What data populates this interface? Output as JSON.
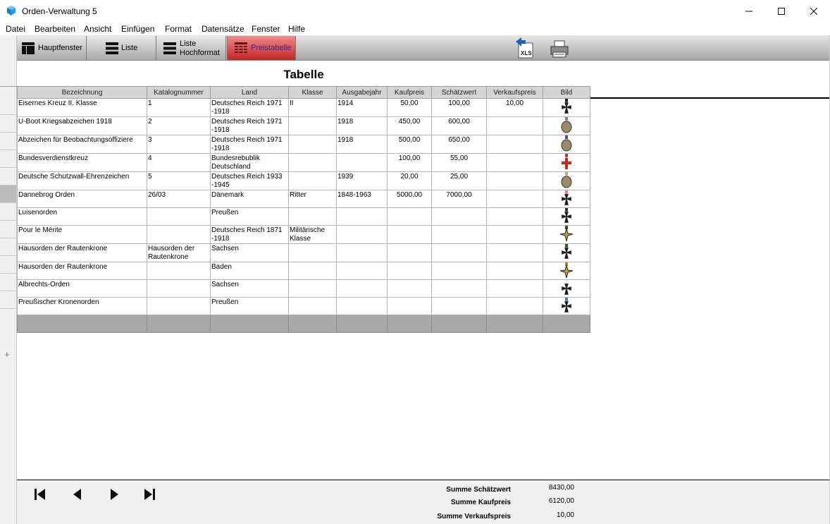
{
  "window": {
    "title": "Orden-Verwaltung 5"
  },
  "menu": [
    "Datei",
    "Bearbeiten",
    "Ansicht",
    "Einfügen",
    "Format",
    "Datensätze",
    "Fenster",
    "Hilfe"
  ],
  "toolbar": {
    "hauptfenster": "Hauptfenster",
    "liste": "Liste",
    "liste_hoch_1": "Liste",
    "liste_hoch_2": "Hochformat",
    "preistabelle": "Preistabelle",
    "xls_label": "XLS"
  },
  "heading": "Tabelle",
  "table": {
    "columns": [
      "Bezeichnung",
      "Katalognummer",
      "Land",
      "Klasse",
      "Ausgabejahr",
      "Kaufpreis",
      "Schätzwert",
      "Verkaufspreis",
      "Bild"
    ],
    "rows": [
      {
        "bezeichnung": "Eisernes Kreuz II. Klasse",
        "katalog": "1",
        "land": "Deutsches Reich 1971 -1918",
        "klasse": "II",
        "jahr": "1914",
        "kauf": "50,00",
        "schaetz": "100,00",
        "verkauf": "10,00",
        "bild": "iron-cross-icon"
      },
      {
        "bezeichnung": "U-Boot Kriegsabzeichen 1918",
        "katalog": "2",
        "land": "Deutsches Reich 1971 -1918",
        "klasse": "",
        "jahr": "1918",
        "kauf": "450,00",
        "schaetz": "600,00",
        "verkauf": "",
        "bild": "submarine-badge-icon"
      },
      {
        "bezeichnung": "Abzeichen für Beobachtungsoffiziere",
        "katalog": "3",
        "land": "Deutsches Reich 1971 -1918",
        "klasse": "",
        "jahr": "1918",
        "kauf": "500,00",
        "schaetz": "650,00",
        "verkauf": "",
        "bild": "oval-badge-icon"
      },
      {
        "bezeichnung": "Bundesverdienstkreuz",
        "katalog": "4",
        "land": "Bundesrebublik Deutschland",
        "klasse": "",
        "jahr": "",
        "kauf": "100,00",
        "schaetz": "55,00",
        "verkauf": "",
        "bild": "red-cross-medal-icon"
      },
      {
        "bezeichnung": "Deutsche Schutzwall-Ehrenzeichen",
        "katalog": "5",
        "land": "Deutsches Reich 1933 -1945",
        "klasse": "",
        "jahr": "1939",
        "kauf": "20,00",
        "schaetz": "25,00",
        "verkauf": "",
        "bild": "oval-medal-icon"
      },
      {
        "bezeichnung": "Dannebrog Orden",
        "katalog": "26/03",
        "land": "Dänemark",
        "klasse": "Ritter",
        "jahr": "1848-1963",
        "kauf": "5000,00",
        "schaetz": "7000,00",
        "verkauf": "",
        "bild": "ribbon-medal-icon"
      },
      {
        "bezeichnung": "Luisenorden",
        "katalog": "",
        "land": "Preußen",
        "klasse": "",
        "jahr": "",
        "kauf": "",
        "schaetz": "",
        "verkauf": "",
        "bild": "black-cross-icon"
      },
      {
        "bezeichnung": "Pour le Mérite",
        "katalog": "",
        "land": "Deutsches Reich 1871 -1918",
        "klasse": "Militärische Klasse",
        "jahr": "",
        "kauf": "",
        "schaetz": "",
        "verkauf": "",
        "bild": "star-cross-icon"
      },
      {
        "bezeichnung": "Hausorden der Rautenkrone",
        "katalog": "Hausorden der Rautenkrone",
        "land": "Sachsen",
        "klasse": "",
        "jahr": "",
        "kauf": "",
        "schaetz": "",
        "verkauf": "",
        "bild": "green-cross-icon"
      },
      {
        "bezeichnung": "Hausorden der Rautenkrone",
        "katalog": "",
        "land": "Baden",
        "klasse": "",
        "jahr": "",
        "kauf": "",
        "schaetz": "",
        "verkauf": "",
        "bild": "gold-star-icon"
      },
      {
        "bezeichnung": "Albrechts-Orden",
        "katalog": "",
        "land": "Sachsen",
        "klasse": "",
        "jahr": "",
        "kauf": "",
        "schaetz": "",
        "verkauf": "",
        "bild": "white-cross-icon"
      },
      {
        "bezeichnung": "Preußischer Kronenorden",
        "katalog": "",
        "land": "Preußen",
        "klasse": "",
        "jahr": "",
        "kauf": "",
        "schaetz": "",
        "verkauf": "",
        "bild": "crown-order-icon"
      }
    ]
  },
  "summary": {
    "schaetz_label": "Summe Schätzwert",
    "schaetz_value": "8430,00",
    "kauf_label": "Summe Kaufpreis",
    "kauf_value": "6120,00",
    "verkauf_label": "Summe Verkaufspreis",
    "verkauf_value": "10,00"
  },
  "colors": {
    "active_tab": "#c22424",
    "toolbar": "#a6a6a6",
    "new_row": "#a8a8a8"
  }
}
